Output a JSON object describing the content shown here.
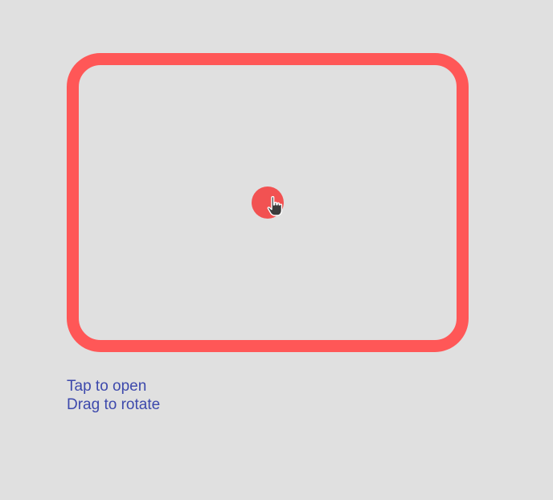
{
  "gesture_area": {
    "frame_color": "#ff5757",
    "background": "#e0e0e0"
  },
  "handle": {
    "color": "#f25252",
    "cursor_icon": "hand-pointer-icon"
  },
  "instructions": {
    "line1": "Tap to open",
    "line2": "Drag to rotate",
    "color": "#3d49ac"
  }
}
